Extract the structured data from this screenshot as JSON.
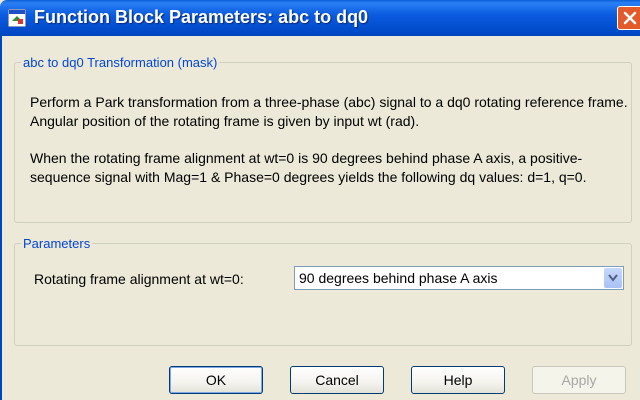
{
  "window": {
    "title": "Function Block Parameters: abc to dq0"
  },
  "mask": {
    "legend": "abc to dq0 Transformation (mask)",
    "description_1": "Perform a Park transformation from a three-phase (abc) signal to a dq0 rotating reference frame. Angular position of the rotating frame is given by input wt (rad).",
    "description_2": "When the rotating frame alignment at wt=0 is 90 degrees behind phase A axis, a positive-sequence signal with Mag=1 & Phase=0 degrees yields the following dq values: d=1, q=0."
  },
  "parameters": {
    "legend": "Parameters",
    "alignment_label": "Rotating frame alignment at wt=0:",
    "alignment_value": "90 degrees behind phase A axis"
  },
  "buttons": {
    "ok": "OK",
    "cancel": "Cancel",
    "help": "Help",
    "apply": "Apply"
  },
  "icons": {
    "app": "simulink-block-icon",
    "close": "close-icon",
    "dropdown": "chevron-down-icon"
  },
  "colors": {
    "titlebar": "#0450d2",
    "close": "#e35b2a",
    "legend": "#0046d5",
    "face": "#ece9d8"
  }
}
